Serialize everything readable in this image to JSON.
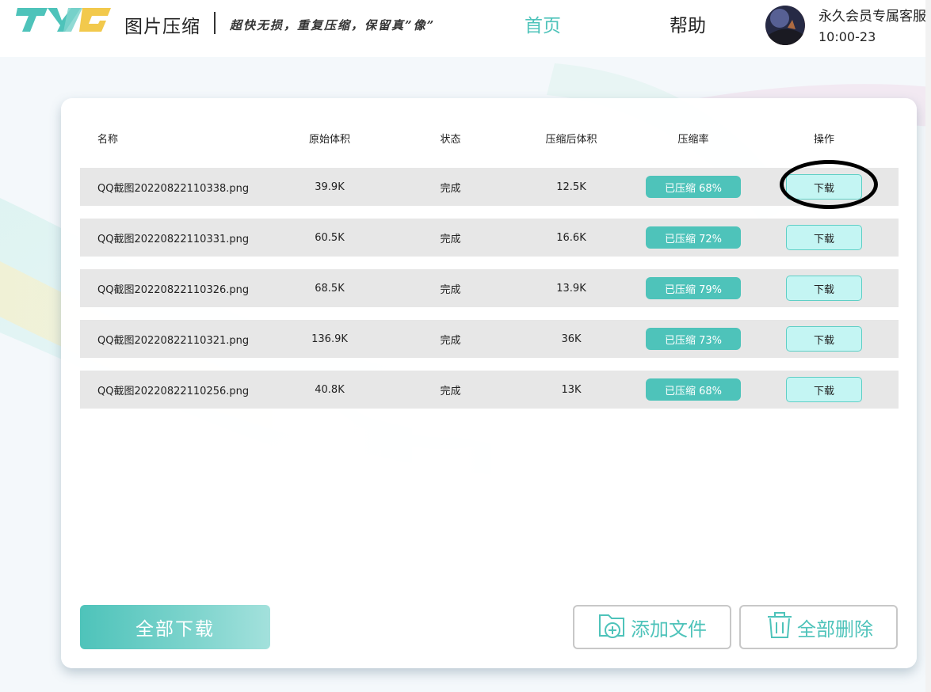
{
  "header": {
    "logo_text": "TYG",
    "app_title": "图片压缩",
    "slogan": "超快无损，重复压缩，保留真”像”",
    "nav": [
      {
        "label": "首页",
        "active": true
      },
      {
        "label": "帮助",
        "active": false
      }
    ],
    "user": {
      "name": "永久会员专属客服",
      "time": "10:00-23"
    }
  },
  "table": {
    "headers": {
      "name": "名称",
      "original": "原始体积",
      "status": "状态",
      "compressed": "压缩后体积",
      "rate": "压缩率",
      "action": "操作"
    },
    "rows": [
      {
        "name": "QQ截图20220822110338.png",
        "original": "39.9K",
        "status": "完成",
        "compressed": "12.5K",
        "rate": "已压缩 68%",
        "action": "下载"
      },
      {
        "name": "QQ截图20220822110331.png",
        "original": "60.5K",
        "status": "完成",
        "compressed": "16.6K",
        "rate": "已压缩 72%",
        "action": "下载"
      },
      {
        "name": "QQ截图20220822110326.png",
        "original": "68.5K",
        "status": "完成",
        "compressed": "13.9K",
        "rate": "已压缩 79%",
        "action": "下载"
      },
      {
        "name": "QQ截图20220822110321.png",
        "original": "136.9K",
        "status": "完成",
        "compressed": "36K",
        "rate": "已压缩 73%",
        "action": "下载"
      },
      {
        "name": "QQ截图20220822110256.png",
        "original": "40.8K",
        "status": "完成",
        "compressed": "13K",
        "rate": "已压缩 68%",
        "action": "下载"
      }
    ]
  },
  "actions": {
    "download_all": "全部下载",
    "add_file": "添加文件",
    "delete_all": "全部删除"
  },
  "colors": {
    "accent": "#4ec3ba",
    "download_button_bg": "#c4f5f3",
    "row_bg": "#e7e7e7",
    "logo_yellow": "#f2c94c"
  },
  "icons": {
    "add_file": "folder-plus-icon",
    "delete_all": "trash-icon"
  }
}
